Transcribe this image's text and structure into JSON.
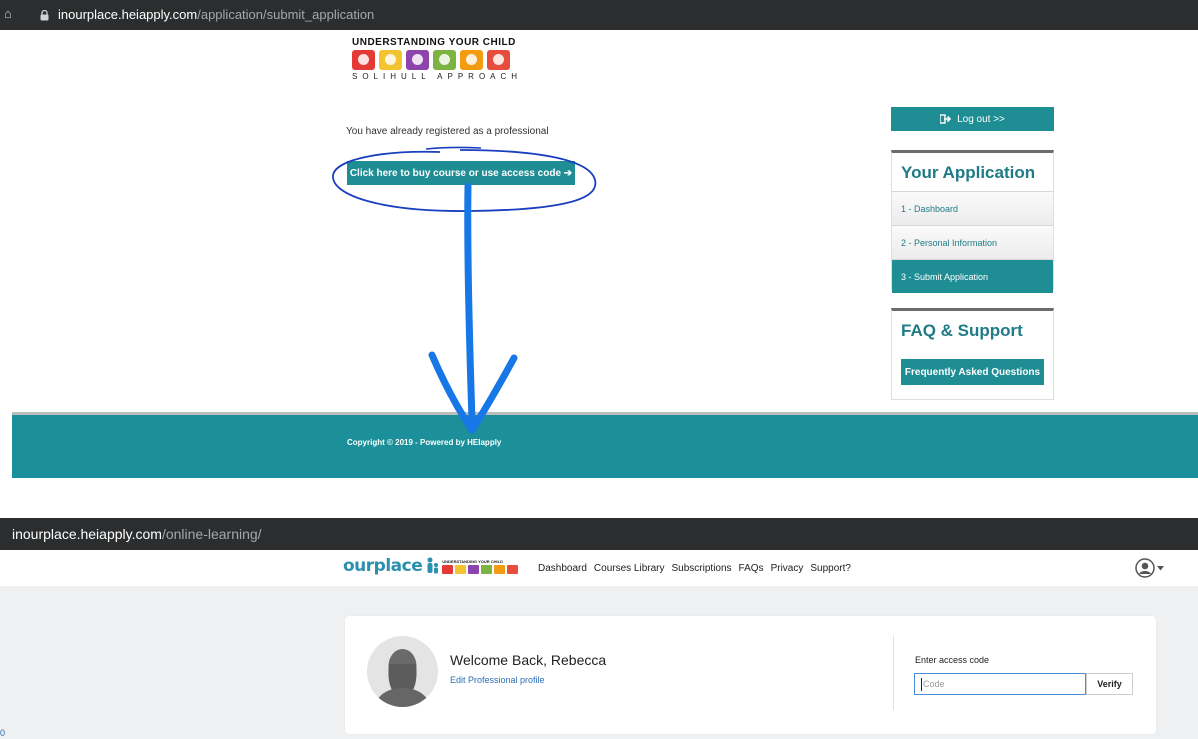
{
  "top": {
    "url_host": "inourplace.heiapply.com",
    "url_path": "/application/submit_application",
    "logo": {
      "line1": "UNDERSTANDING YOUR CHILD",
      "line2": "SOLIHULL APPROACH"
    },
    "registered_text": "You have already registered as a professional",
    "buy_button": "Click here to buy course or use access code ➔",
    "logout_button": "Log out >>",
    "application_panel": {
      "title": "Your Application",
      "items": [
        "1 - Dashboard",
        "2 - Personal Information",
        "3 - Submit Application"
      ],
      "active_index": 2
    },
    "faq_panel": {
      "title": "FAQ & Support",
      "button": "Frequently Asked Questions"
    },
    "footer": "Copyright © 2019 - Powered by HEIapply"
  },
  "bottom": {
    "url_host": "inourplace.heiapply.com",
    "url_path": "/online-learning/",
    "brand": "ourplace",
    "nav": [
      "Dashboard",
      "Courses Library",
      "Subscriptions",
      "FAQs",
      "Privacy",
      "Support?"
    ],
    "welcome": "Welcome Back, Rebecca",
    "edit_profile": "Edit Professional profile",
    "access_code_label": "Enter access code",
    "code_placeholder": "Code",
    "verify_button": "Verify",
    "corner_text": "0"
  },
  "colors": {
    "teal": "#1f8d94",
    "footer": "#1b8f9a",
    "annotation": "#1a5fd6",
    "urlbar": "#2b2d2f"
  },
  "icons": [
    "lock-icon",
    "sign-out-icon",
    "arrow-right-icon",
    "user-avatar-icon",
    "chevron-down-icon"
  ]
}
